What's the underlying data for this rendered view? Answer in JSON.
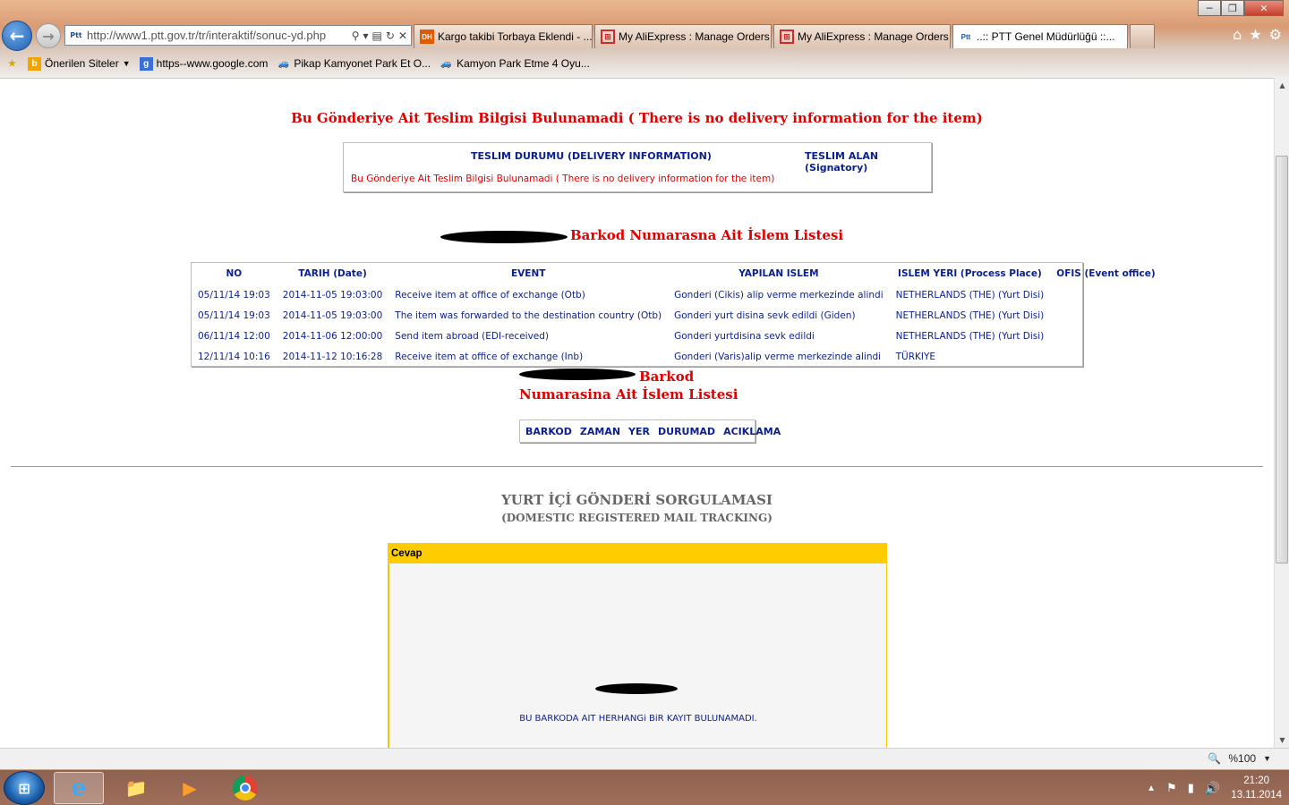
{
  "browser": {
    "address": "http://www1.ptt.gov.tr/tr/interaktif/sonuc-yd.php",
    "tabs": [
      {
        "label": "Kargo takibi Torbaya Eklendi - ...",
        "icon": "dh-favicon"
      },
      {
        "label": "My AliExpress : Manage Orders",
        "icon": "aliexpress-favicon"
      },
      {
        "label": "My AliExpress : Manage Orders",
        "icon": "aliexpress-favicon"
      },
      {
        "label": "..:: PTT Genel Müdürlüğü ::...",
        "icon": "ptt-favicon"
      }
    ],
    "favorites": [
      {
        "label": "Önerilen Siteler",
        "icon": "bing-icon"
      },
      {
        "label": "https--www.google.com",
        "icon": "google-icon"
      },
      {
        "label": "Pikap Kamyonet Park Et O...",
        "icon": "car-icon"
      },
      {
        "label": "Kamyon Park Etme 4 Oyu...",
        "icon": "car-icon"
      }
    ]
  },
  "page": {
    "top_notice": "Bu Gönderiye Ait Teslim Bilgisi Bulunamadi ( There is no delivery information for the item)",
    "delivery_box": {
      "col1": "TESLIM DURUMU (DELIVERY INFORMATION)",
      "col2": "TESLIM ALAN (Signatory)",
      "message": "Bu Gönderiye Ait Teslim Bilgisi Bulunamadi ( There is no delivery information for the item)"
    },
    "list_title": "Barkod Numarasna Ait İslem Listesi",
    "events_table": {
      "headers": [
        "NO",
        "TARIH (Date)",
        "EVENT",
        "YAPILAN ISLEM",
        "ISLEM YERI (Process Place)",
        "OFIS (Event office)"
      ],
      "rows": [
        [
          "05/11/14 19:03",
          "2014-11-05 19:03:00",
          "Receive item at office of exchange (Otb)",
          "Gonderi (Cikis) alip verme merkezinde alindi",
          "NETHERLANDS (THE) (Yurt Disi)",
          ""
        ],
        [
          "05/11/14 19:03",
          "2014-11-05 19:03:00",
          "The item was forwarded to the destination country (Otb)",
          "Gonderi yurt disina sevk edildi (Giden)",
          "NETHERLANDS (THE) (Yurt Disi)",
          ""
        ],
        [
          "06/11/14 12:00",
          "2014-11-06 12:00:00",
          "Send item abroad (EDI-received)",
          "Gonderi yurtdisina sevk edildi",
          "NETHERLANDS (THE) (Yurt Disi)",
          ""
        ],
        [
          "12/11/14 10:16",
          "2014-11-12 10:16:28",
          "Receive item at office of exchange (Inb)",
          "Gonderi (Varis)alip verme merkezinde alindi",
          "TÜRKIYE",
          ""
        ]
      ]
    },
    "second_list_title_line1": "Barkod",
    "second_list_title_line2": "Numarasina Ait İslem Listesi",
    "small_table_headers": [
      "BARKOD",
      "ZAMAN",
      "YER",
      "DURUMAD",
      "ACIKLAMA"
    ],
    "domestic_title": "YURT İÇİ GÖNDERİ SORGULAMASI",
    "domestic_subtitle": "(DOMESTIC REGISTERED MAIL TRACKING)",
    "answer_header": "Cevap",
    "answer_message": "BU BARKODA AIT HERHANGi BiR KAYIT BULUNAMADI."
  },
  "statusbar": {
    "zoom": "%100"
  },
  "taskbar": {
    "time": "21:20",
    "date": "13.11.2014"
  },
  "colors": {
    "title_red": "#e00000",
    "link_blue": "#0a1f8f",
    "answer_yellow": "#ffcc00"
  }
}
